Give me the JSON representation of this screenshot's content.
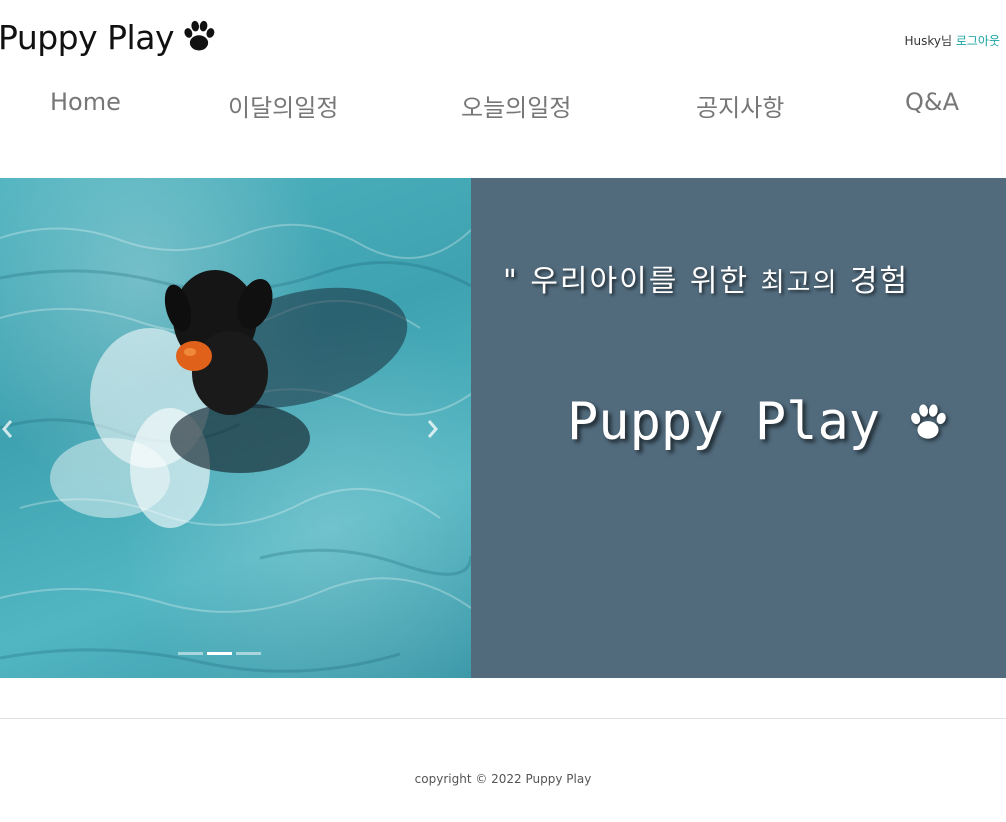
{
  "header": {
    "brand": "Puppy Play",
    "brand_icon": "paw-icon",
    "user_name": "Husky님",
    "logout_label": "로그아웃"
  },
  "nav": {
    "items": [
      {
        "label": "Home"
      },
      {
        "label": "이달의일정"
      },
      {
        "label": "오늘의일정"
      },
      {
        "label": "공지사항"
      },
      {
        "label": "Q&A"
      }
    ]
  },
  "hero": {
    "tagline_main": "\" 우리아이를 위한 ",
    "tagline_small": "최고의",
    "tagline_end": " 경험",
    "title": "Puppy Play",
    "title_icon": "paw-icon",
    "panel_color": "#516b7d",
    "carousel": {
      "image": "dog-swimming-in-pool-photo",
      "slide_count": 3,
      "active_slide": 2
    }
  },
  "footer": {
    "copyright": "copyright © 2022 Puppy Play"
  },
  "colors": {
    "accent": "#1aa3a3",
    "nav_text": "#777777"
  }
}
